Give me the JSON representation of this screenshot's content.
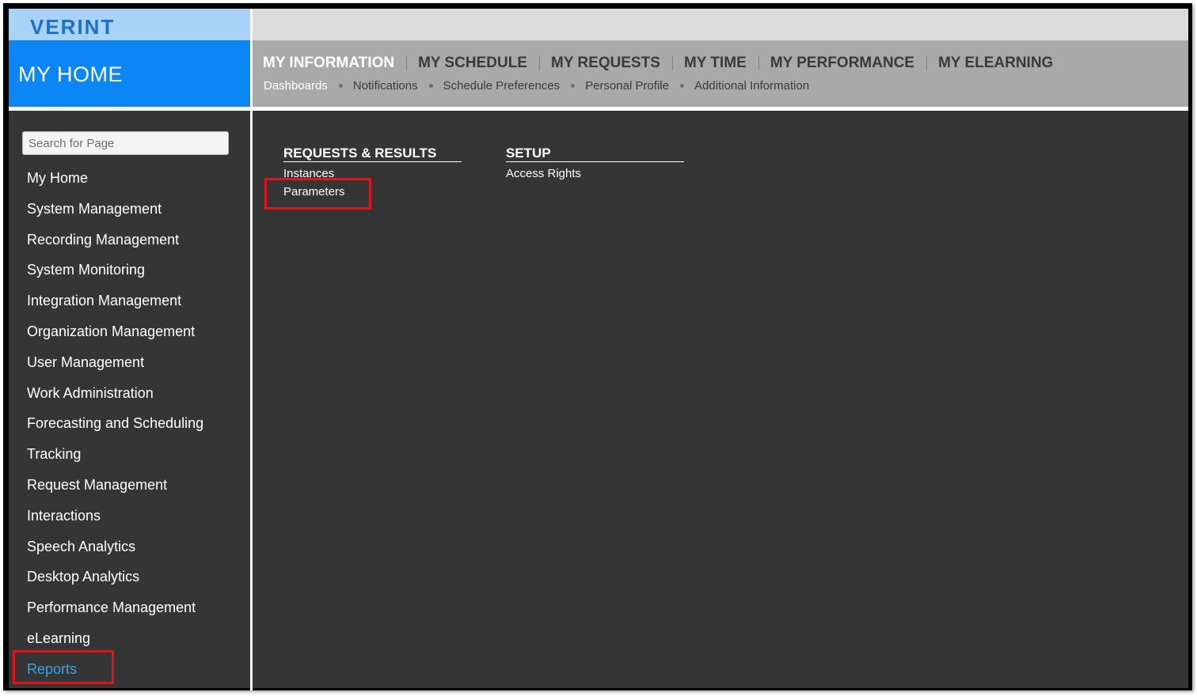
{
  "brand": {
    "logo": "VERINT"
  },
  "home": {
    "title": "MY HOME"
  },
  "main_nav": [
    {
      "label": "MY INFORMATION",
      "active": true
    },
    {
      "label": "MY SCHEDULE"
    },
    {
      "label": "MY REQUESTS"
    },
    {
      "label": "MY TIME"
    },
    {
      "label": "MY PERFORMANCE"
    },
    {
      "label": "MY ELEARNING"
    }
  ],
  "sub_nav": [
    {
      "label": "Dashboards",
      "active": true
    },
    {
      "label": "Notifications"
    },
    {
      "label": "Schedule Preferences"
    },
    {
      "label": "Personal Profile"
    },
    {
      "label": "Additional Information"
    }
  ],
  "search": {
    "placeholder": "Search for Page"
  },
  "sidebar": {
    "items": [
      {
        "label": "My Home"
      },
      {
        "label": "System Management"
      },
      {
        "label": "Recording Management"
      },
      {
        "label": "System Monitoring"
      },
      {
        "label": "Integration Management"
      },
      {
        "label": "Organization Management"
      },
      {
        "label": "User Management"
      },
      {
        "label": "Work Administration"
      },
      {
        "label": "Forecasting and Scheduling"
      },
      {
        "label": "Tracking"
      },
      {
        "label": "Request Management"
      },
      {
        "label": "Interactions"
      },
      {
        "label": "Speech Analytics"
      },
      {
        "label": "Desktop Analytics"
      },
      {
        "label": "Performance Management"
      },
      {
        "label": "eLearning"
      },
      {
        "label": "Reports",
        "active": true
      }
    ]
  },
  "content": {
    "sections": [
      {
        "title": "REQUESTS & RESULTS",
        "links": [
          "Instances",
          "Parameters"
        ]
      },
      {
        "title": "SETUP",
        "links": [
          "Access Rights"
        ]
      }
    ]
  },
  "colors": {
    "brand_bar": "#a8d2f7",
    "home_header": "#0d86f5",
    "nav_bar": "#a9a9a9",
    "panel_bg": "#353535",
    "active_link": "#3aa3e0",
    "highlight": "#e1141b"
  }
}
